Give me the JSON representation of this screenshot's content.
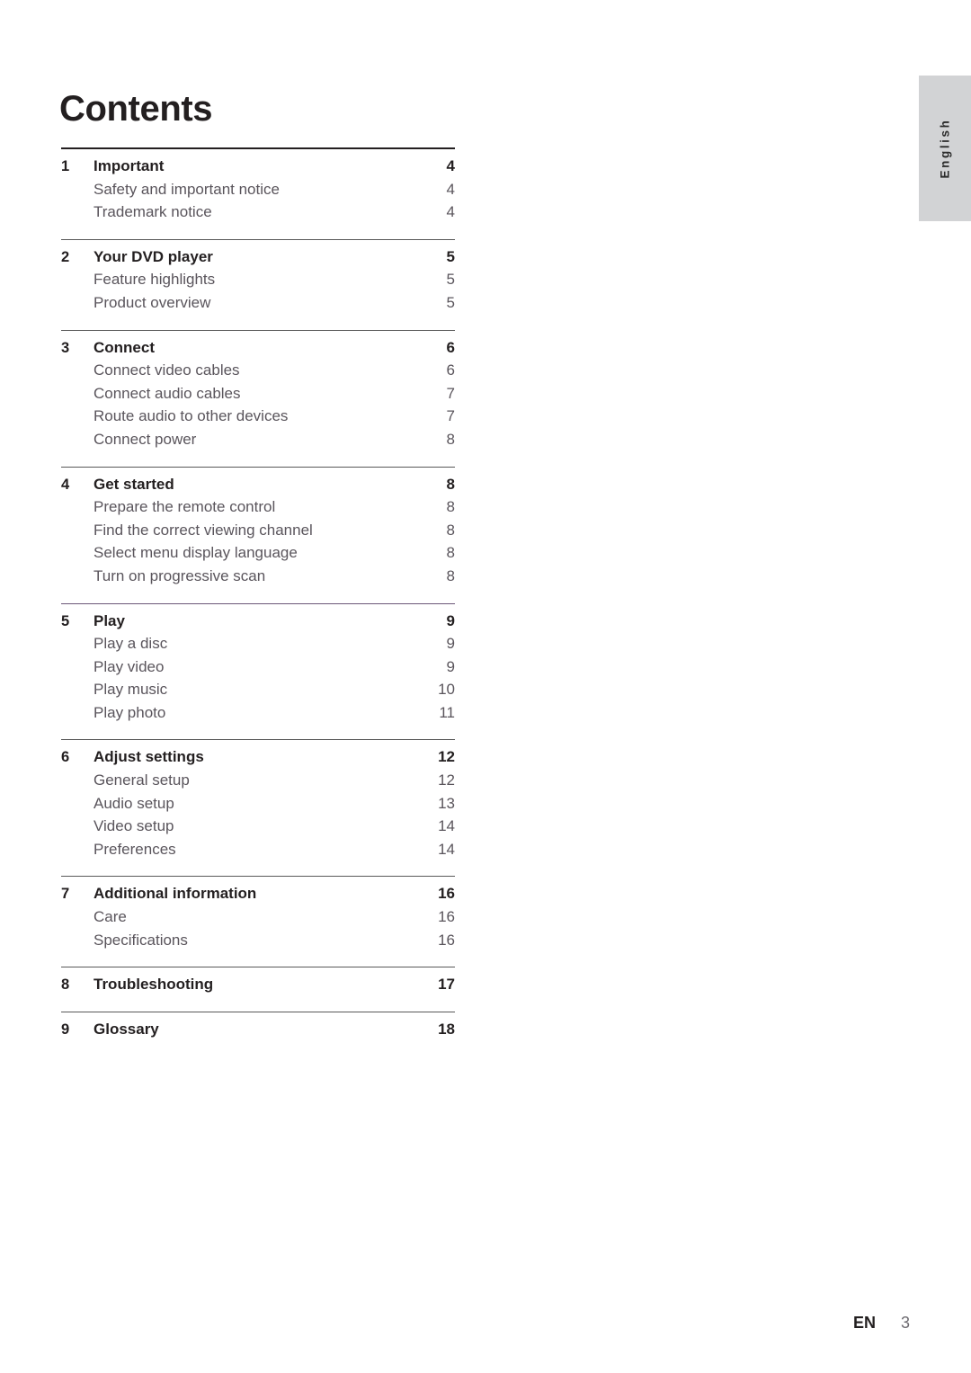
{
  "page": {
    "title": "Contents",
    "language_tab": "English",
    "footer": {
      "locale": "EN",
      "number": "3"
    }
  },
  "toc": {
    "groups": [
      {
        "rule": "thick",
        "rows": [
          {
            "num": "1",
            "label": "Important",
            "page": "4",
            "level": "section"
          },
          {
            "num": "",
            "label": "Safety and important notice",
            "page": "4",
            "level": "item"
          },
          {
            "num": "",
            "label": "Trademark notice",
            "page": "4",
            "level": "item"
          }
        ]
      },
      {
        "rule": "normal",
        "rows": [
          {
            "num": "2",
            "label": "Your DVD player",
            "page": "5",
            "level": "section"
          },
          {
            "num": "",
            "label": "Feature highlights",
            "page": "5",
            "level": "item"
          },
          {
            "num": "",
            "label": "Product overview",
            "page": "5",
            "level": "item"
          }
        ]
      },
      {
        "rule": "normal",
        "rows": [
          {
            "num": "3",
            "label": "Connect",
            "page": "6",
            "level": "section"
          },
          {
            "num": "",
            "label": "Connect video cables",
            "page": "6",
            "level": "item"
          },
          {
            "num": "",
            "label": "Connect audio cables",
            "page": "7",
            "level": "item"
          },
          {
            "num": "",
            "label": "Route audio to other devices",
            "page": "7",
            "level": "item"
          },
          {
            "num": "",
            "label": "Connect power",
            "page": "8",
            "level": "item"
          }
        ]
      },
      {
        "rule": "normal",
        "rows": [
          {
            "num": "4",
            "label": "Get started",
            "page": "8",
            "level": "section"
          },
          {
            "num": "",
            "label": "Prepare the remote control",
            "page": "8",
            "level": "item"
          },
          {
            "num": "",
            "label": "Find the correct viewing channel",
            "page": "8",
            "level": "item"
          },
          {
            "num": "",
            "label": "Select menu display language",
            "page": "8",
            "level": "item"
          },
          {
            "num": "",
            "label": "Turn on progressive scan",
            "page": "8",
            "level": "item"
          }
        ]
      },
      {
        "rule": "tinted",
        "rows": [
          {
            "num": "5",
            "label": "Play",
            "page": "9",
            "level": "section"
          },
          {
            "num": "",
            "label": "Play a disc",
            "page": "9",
            "level": "item"
          },
          {
            "num": "",
            "label": "Play video",
            "page": "9",
            "level": "item"
          },
          {
            "num": "",
            "label": "Play music",
            "page": "10",
            "level": "item"
          },
          {
            "num": "",
            "label": "Play photo",
            "page": "11",
            "level": "item"
          }
        ]
      },
      {
        "rule": "normal",
        "rows": [
          {
            "num": "6",
            "label": "Adjust settings",
            "page": "12",
            "level": "section"
          },
          {
            "num": "",
            "label": "General setup",
            "page": "12",
            "level": "item"
          },
          {
            "num": "",
            "label": "Audio setup",
            "page": "13",
            "level": "item"
          },
          {
            "num": "",
            "label": "Video setup",
            "page": "14",
            "level": "item"
          },
          {
            "num": "",
            "label": "Preferences",
            "page": "14",
            "level": "item"
          }
        ]
      },
      {
        "rule": "normal",
        "rows": [
          {
            "num": "7",
            "label": "Additional information",
            "page": "16",
            "level": "section"
          },
          {
            "num": "",
            "label": "Care",
            "page": "16",
            "level": "item"
          },
          {
            "num": "",
            "label": "Specifications",
            "page": "16",
            "level": "item"
          }
        ]
      },
      {
        "rule": "normal",
        "rows": [
          {
            "num": "8",
            "label": "Troubleshooting",
            "page": "17",
            "level": "section"
          }
        ]
      },
      {
        "rule": "normal",
        "rows": [
          {
            "num": "9",
            "label": "Glossary",
            "page": "18",
            "level": "section"
          }
        ]
      }
    ]
  },
  "colors": {
    "heading": "#231f20",
    "item_text": "#5a555c",
    "rule": "#595959",
    "rule_tinted": "#6b5778",
    "tab_background": "#d2d3d5"
  }
}
